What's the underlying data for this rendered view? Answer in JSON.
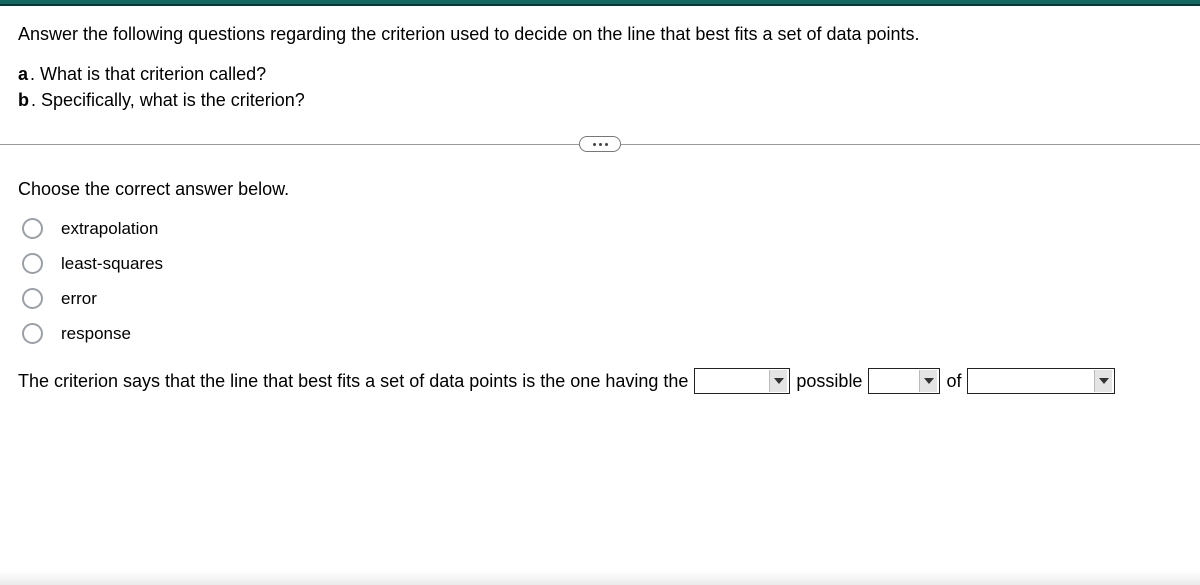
{
  "question": {
    "intro": "Answer the following questions regarding the criterion used to decide on the line that best fits a set of data points.",
    "parts": [
      {
        "letter": "a",
        "text": "What is that criterion called?"
      },
      {
        "letter": "b",
        "text": "Specifically, what is the criterion?"
      }
    ]
  },
  "choose_prompt": "Choose the correct answer below.",
  "options": [
    {
      "label": "extrapolation"
    },
    {
      "label": "least-squares"
    },
    {
      "label": "error"
    },
    {
      "label": "response"
    }
  ],
  "sentence": {
    "part1": "The criterion says that the line that best fits a set of data points is the one having the",
    "word_possible": "possible",
    "word_of": "of"
  }
}
